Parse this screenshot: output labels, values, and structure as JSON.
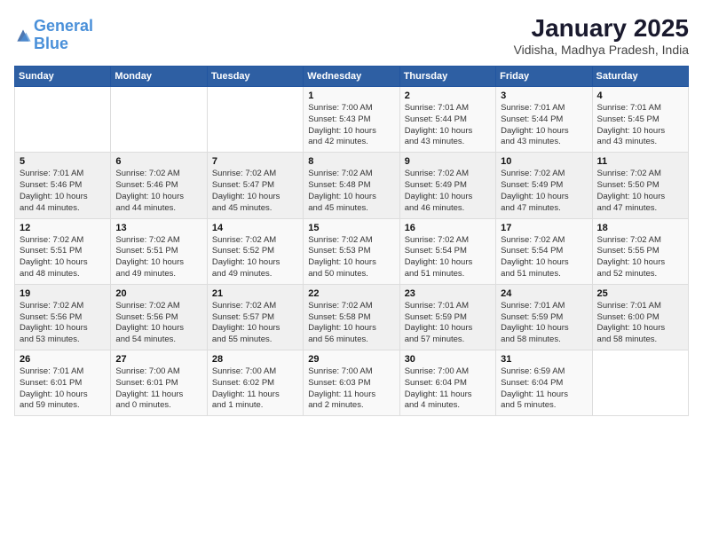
{
  "logo": {
    "line1": "General",
    "line2": "Blue"
  },
  "title": "January 2025",
  "subtitle": "Vidisha, Madhya Pradesh, India",
  "weekdays": [
    "Sunday",
    "Monday",
    "Tuesday",
    "Wednesday",
    "Thursday",
    "Friday",
    "Saturday"
  ],
  "weeks": [
    [
      {
        "day": "",
        "info": ""
      },
      {
        "day": "",
        "info": ""
      },
      {
        "day": "",
        "info": ""
      },
      {
        "day": "1",
        "info": "Sunrise: 7:00 AM\nSunset: 5:43 PM\nDaylight: 10 hours\nand 42 minutes."
      },
      {
        "day": "2",
        "info": "Sunrise: 7:01 AM\nSunset: 5:44 PM\nDaylight: 10 hours\nand 43 minutes."
      },
      {
        "day": "3",
        "info": "Sunrise: 7:01 AM\nSunset: 5:44 PM\nDaylight: 10 hours\nand 43 minutes."
      },
      {
        "day": "4",
        "info": "Sunrise: 7:01 AM\nSunset: 5:45 PM\nDaylight: 10 hours\nand 43 minutes."
      }
    ],
    [
      {
        "day": "5",
        "info": "Sunrise: 7:01 AM\nSunset: 5:46 PM\nDaylight: 10 hours\nand 44 minutes."
      },
      {
        "day": "6",
        "info": "Sunrise: 7:02 AM\nSunset: 5:46 PM\nDaylight: 10 hours\nand 44 minutes."
      },
      {
        "day": "7",
        "info": "Sunrise: 7:02 AM\nSunset: 5:47 PM\nDaylight: 10 hours\nand 45 minutes."
      },
      {
        "day": "8",
        "info": "Sunrise: 7:02 AM\nSunset: 5:48 PM\nDaylight: 10 hours\nand 45 minutes."
      },
      {
        "day": "9",
        "info": "Sunrise: 7:02 AM\nSunset: 5:49 PM\nDaylight: 10 hours\nand 46 minutes."
      },
      {
        "day": "10",
        "info": "Sunrise: 7:02 AM\nSunset: 5:49 PM\nDaylight: 10 hours\nand 47 minutes."
      },
      {
        "day": "11",
        "info": "Sunrise: 7:02 AM\nSunset: 5:50 PM\nDaylight: 10 hours\nand 47 minutes."
      }
    ],
    [
      {
        "day": "12",
        "info": "Sunrise: 7:02 AM\nSunset: 5:51 PM\nDaylight: 10 hours\nand 48 minutes."
      },
      {
        "day": "13",
        "info": "Sunrise: 7:02 AM\nSunset: 5:51 PM\nDaylight: 10 hours\nand 49 minutes."
      },
      {
        "day": "14",
        "info": "Sunrise: 7:02 AM\nSunset: 5:52 PM\nDaylight: 10 hours\nand 49 minutes."
      },
      {
        "day": "15",
        "info": "Sunrise: 7:02 AM\nSunset: 5:53 PM\nDaylight: 10 hours\nand 50 minutes."
      },
      {
        "day": "16",
        "info": "Sunrise: 7:02 AM\nSunset: 5:54 PM\nDaylight: 10 hours\nand 51 minutes."
      },
      {
        "day": "17",
        "info": "Sunrise: 7:02 AM\nSunset: 5:54 PM\nDaylight: 10 hours\nand 51 minutes."
      },
      {
        "day": "18",
        "info": "Sunrise: 7:02 AM\nSunset: 5:55 PM\nDaylight: 10 hours\nand 52 minutes."
      }
    ],
    [
      {
        "day": "19",
        "info": "Sunrise: 7:02 AM\nSunset: 5:56 PM\nDaylight: 10 hours\nand 53 minutes."
      },
      {
        "day": "20",
        "info": "Sunrise: 7:02 AM\nSunset: 5:56 PM\nDaylight: 10 hours\nand 54 minutes."
      },
      {
        "day": "21",
        "info": "Sunrise: 7:02 AM\nSunset: 5:57 PM\nDaylight: 10 hours\nand 55 minutes."
      },
      {
        "day": "22",
        "info": "Sunrise: 7:02 AM\nSunset: 5:58 PM\nDaylight: 10 hours\nand 56 minutes."
      },
      {
        "day": "23",
        "info": "Sunrise: 7:01 AM\nSunset: 5:59 PM\nDaylight: 10 hours\nand 57 minutes."
      },
      {
        "day": "24",
        "info": "Sunrise: 7:01 AM\nSunset: 5:59 PM\nDaylight: 10 hours\nand 58 minutes."
      },
      {
        "day": "25",
        "info": "Sunrise: 7:01 AM\nSunset: 6:00 PM\nDaylight: 10 hours\nand 58 minutes."
      }
    ],
    [
      {
        "day": "26",
        "info": "Sunrise: 7:01 AM\nSunset: 6:01 PM\nDaylight: 10 hours\nand 59 minutes."
      },
      {
        "day": "27",
        "info": "Sunrise: 7:00 AM\nSunset: 6:01 PM\nDaylight: 11 hours\nand 0 minutes."
      },
      {
        "day": "28",
        "info": "Sunrise: 7:00 AM\nSunset: 6:02 PM\nDaylight: 11 hours\nand 1 minute."
      },
      {
        "day": "29",
        "info": "Sunrise: 7:00 AM\nSunset: 6:03 PM\nDaylight: 11 hours\nand 2 minutes."
      },
      {
        "day": "30",
        "info": "Sunrise: 7:00 AM\nSunset: 6:04 PM\nDaylight: 11 hours\nand 4 minutes."
      },
      {
        "day": "31",
        "info": "Sunrise: 6:59 AM\nSunset: 6:04 PM\nDaylight: 11 hours\nand 5 minutes."
      },
      {
        "day": "",
        "info": ""
      }
    ]
  ]
}
